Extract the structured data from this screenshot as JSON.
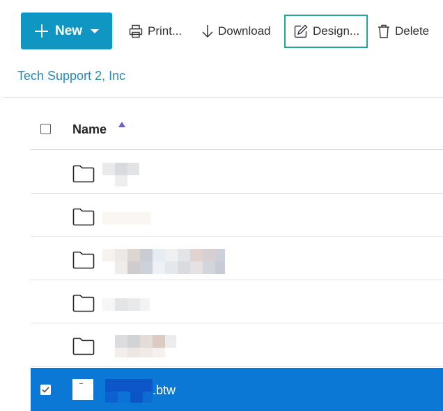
{
  "toolbar": {
    "new_label": "New",
    "print_label": "Print...",
    "download_label": "Download",
    "design_label": "Design...",
    "delete_label": "Delete"
  },
  "breadcrumb": "Tech Support 2, Inc",
  "table": {
    "header_name": "Name",
    "rows": [
      {
        "type": "folder",
        "name": ""
      },
      {
        "type": "folder",
        "name": ""
      },
      {
        "type": "folder",
        "name": ""
      },
      {
        "type": "folder",
        "name": ""
      },
      {
        "type": "folder",
        "name": ""
      },
      {
        "type": "file",
        "name": ".btw",
        "selected": true
      }
    ]
  },
  "colors": {
    "new_button": "#0f96c3",
    "focus_outline": "#1ea896",
    "selected_row": "#0a78d4",
    "breadcrumb": "#2a8ab3"
  },
  "icons": [
    "plus-icon",
    "chevron-down-icon",
    "printer-icon",
    "download-icon",
    "edit-icon",
    "trash-icon",
    "folder-icon",
    "sort-ascending-icon",
    "checkmark-icon",
    "file-icon"
  ]
}
